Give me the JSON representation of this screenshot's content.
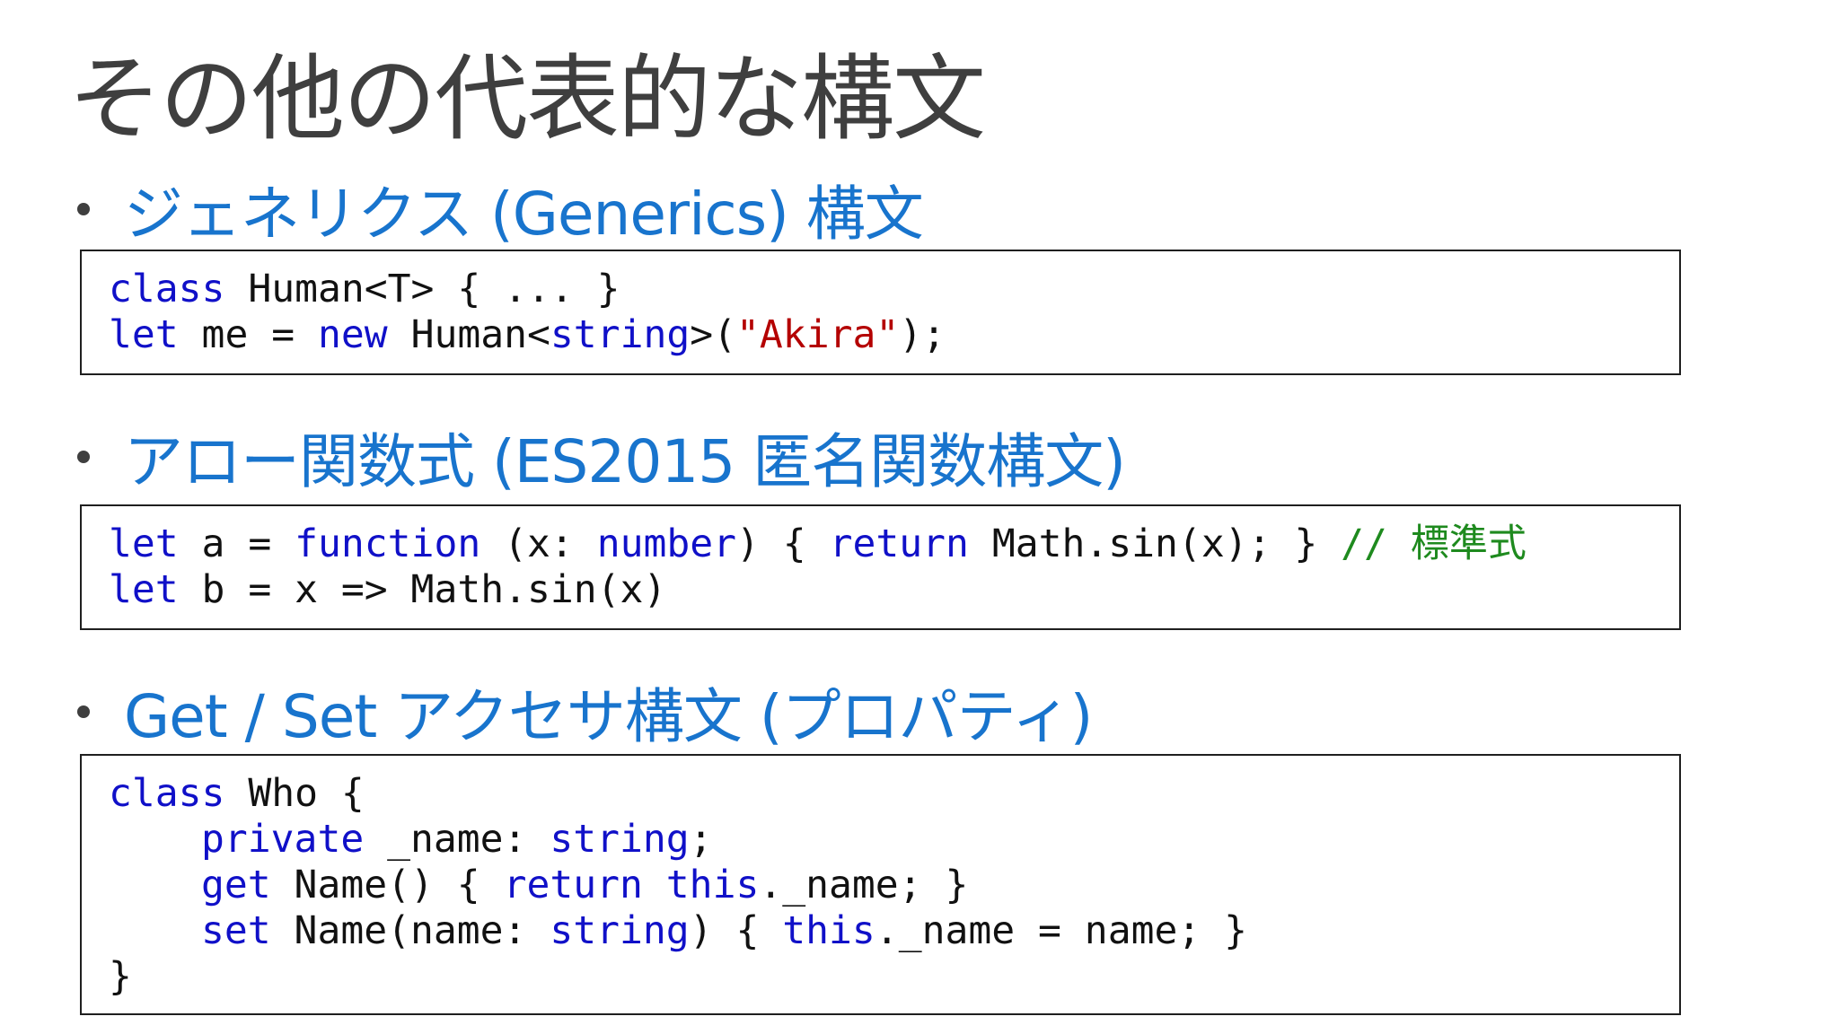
{
  "slide": {
    "title": "その他の代表的な構文"
  },
  "sections": [
    {
      "heading": "ジェネリクス (Generics) 構文",
      "code": [
        [
          {
            "t": "kw",
            "v": "class"
          },
          {
            "t": "plain",
            "v": " Human<T> { ... }"
          }
        ],
        [
          {
            "t": "kw",
            "v": "let"
          },
          {
            "t": "plain",
            "v": " me = "
          },
          {
            "t": "kw",
            "v": "new"
          },
          {
            "t": "plain",
            "v": " Human<"
          },
          {
            "t": "kw",
            "v": "string"
          },
          {
            "t": "plain",
            "v": ">("
          },
          {
            "t": "str",
            "v": "\"Akira\""
          },
          {
            "t": "plain",
            "v": ");"
          }
        ]
      ]
    },
    {
      "heading": "アロー関数式 (ES2015 匿名関数構文)",
      "code": [
        [
          {
            "t": "kw",
            "v": "let"
          },
          {
            "t": "plain",
            "v": " a = "
          },
          {
            "t": "kw",
            "v": "function"
          },
          {
            "t": "plain",
            "v": " (x: "
          },
          {
            "t": "kw",
            "v": "number"
          },
          {
            "t": "plain",
            "v": ") { "
          },
          {
            "t": "kw",
            "v": "return"
          },
          {
            "t": "plain",
            "v": " Math.sin(x); } "
          },
          {
            "t": "cmt",
            "v": "// 標準式"
          }
        ],
        [
          {
            "t": "kw",
            "v": "let"
          },
          {
            "t": "plain",
            "v": " b = x => Math.sin(x)"
          }
        ]
      ]
    },
    {
      "heading": "Get / Set アクセサ構文 (プロパティ)",
      "code": [
        [
          {
            "t": "kw",
            "v": "class"
          },
          {
            "t": "plain",
            "v": " Who {"
          }
        ],
        [
          {
            "t": "indent",
            "v": ""
          },
          {
            "t": "kw",
            "v": "private"
          },
          {
            "t": "plain",
            "v": " _name: "
          },
          {
            "t": "kw",
            "v": "string"
          },
          {
            "t": "plain",
            "v": ";"
          }
        ],
        [
          {
            "t": "indent",
            "v": ""
          },
          {
            "t": "kw",
            "v": "get"
          },
          {
            "t": "plain",
            "v": " Name() { "
          },
          {
            "t": "kw",
            "v": "return"
          },
          {
            "t": "plain",
            "v": " "
          },
          {
            "t": "kw",
            "v": "this"
          },
          {
            "t": "plain",
            "v": "._name; }"
          }
        ],
        [
          {
            "t": "indent",
            "v": ""
          },
          {
            "t": "kw",
            "v": "set"
          },
          {
            "t": "plain",
            "v": " Name(name: "
          },
          {
            "t": "kw",
            "v": "string"
          },
          {
            "t": "plain",
            "v": ") { "
          },
          {
            "t": "kw",
            "v": "this"
          },
          {
            "t": "plain",
            "v": "._name = name; }"
          }
        ],
        [
          {
            "t": "plain",
            "v": "}"
          }
        ]
      ]
    }
  ],
  "colors": {
    "title": "#3f3f3f",
    "heading": "#1874cd",
    "keyword": "#1010c8",
    "string": "#b40000",
    "comment": "#1e8a1e"
  }
}
